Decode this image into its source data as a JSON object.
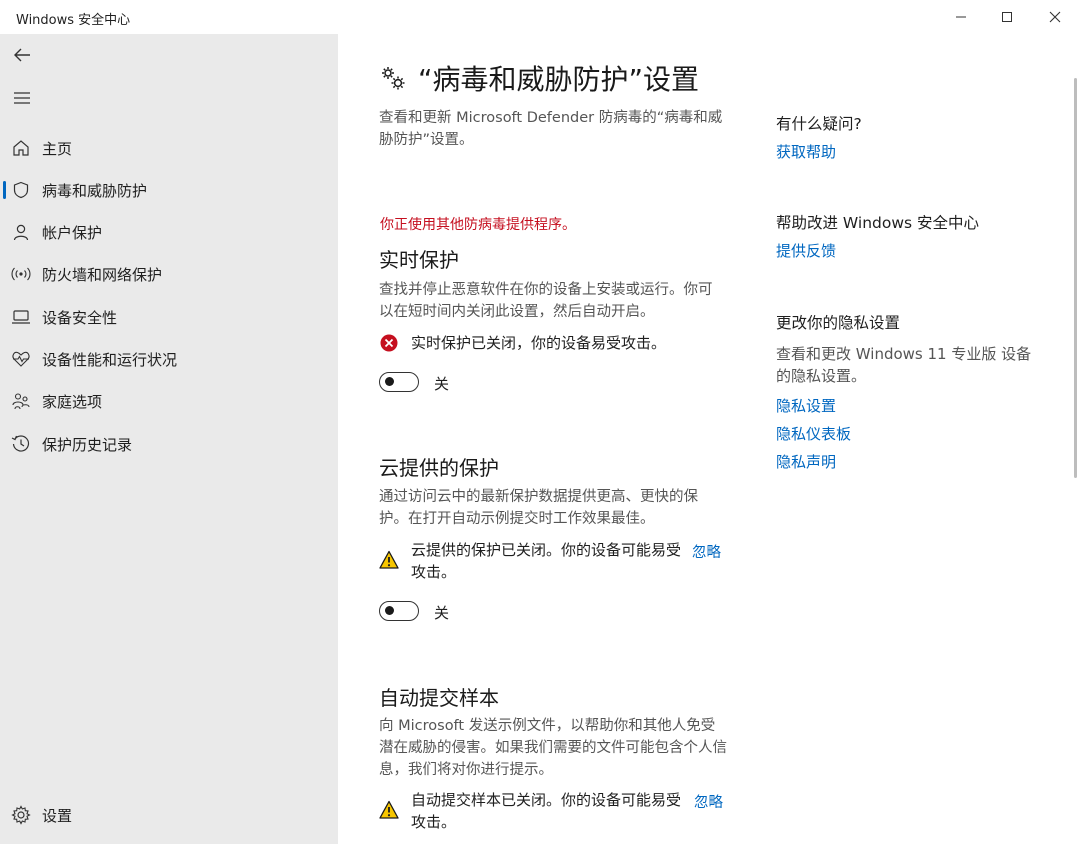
{
  "window": {
    "title": "Windows 安全中心"
  },
  "sidebar": {
    "items": [
      {
        "label": "主页",
        "icon": "home-icon"
      },
      {
        "label": "病毒和威胁防护",
        "icon": "shield-icon",
        "active": true
      },
      {
        "label": "帐户保护",
        "icon": "person-icon"
      },
      {
        "label": "防火墙和网络保护",
        "icon": "wifi-antenna-icon"
      },
      {
        "label": "设备安全性",
        "icon": "laptop-icon"
      },
      {
        "label": "设备性能和运行状况",
        "icon": "heartbeat-icon"
      },
      {
        "label": "家庭选项",
        "icon": "family-icon"
      },
      {
        "label": "保护历史记录",
        "icon": "history-icon"
      }
    ],
    "settings_label": "设置"
  },
  "main": {
    "title": "“病毒和威胁防护”设置",
    "description": "查看和更新 Microsoft Defender 防病毒的“病毒和威胁防护”设置。",
    "warning": "你正使用其他防病毒提供程序。",
    "realtime": {
      "title": "实时保护",
      "description": "查找并停止恶意软件在你的设备上安装或运行。你可以在短时间内关闭此设置，然后自动开启。",
      "status": "实时保护已关闭，你的设备易受攻击。",
      "toggle_label": "关"
    },
    "cloud": {
      "title": "云提供的保护",
      "description": "通过访问云中的最新保护数据提供更高、更快的保护。在打开自动示例提交时工作效果最佳。",
      "status": "云提供的保护已关闭。你的设备可能易受攻击。",
      "ignore": "忽略",
      "toggle_label": "关"
    },
    "sample": {
      "title": "自动提交样本",
      "description": "向 Microsoft 发送示例文件，以帮助你和其他人免受潜在威胁的侵害。如果我们需要的文件可能包含个人信息，我们将对你进行提示。",
      "status": "自动提交样本已关闭。你的设备可能易受攻击。",
      "ignore": "忽略"
    }
  },
  "right": {
    "question_heading": "有什么疑问?",
    "get_help": "获取帮助",
    "improve_heading": "帮助改进 Windows 安全中心",
    "feedback": "提供反馈",
    "privacy_heading": "更改你的隐私设置",
    "privacy_text": "查看和更改 Windows 11 专业版 设备的隐私设置。",
    "privacy_settings": "隐私设置",
    "privacy_dashboard": "隐私仪表板",
    "privacy_statement": "隐私声明"
  },
  "colors": {
    "accent": "#0067c0",
    "error": "#c50f1f",
    "warning": "#f7c600",
    "sidebar_bg": "#eaeaea"
  }
}
